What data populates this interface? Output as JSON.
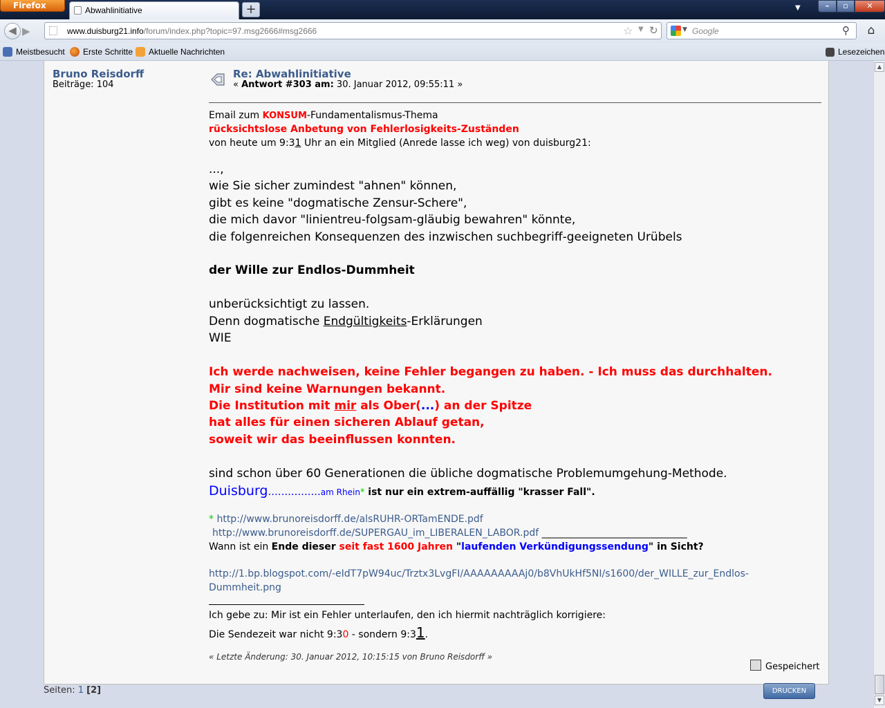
{
  "browser": {
    "menu_button": "Firefox",
    "tab_title": "Abwahlinitiative",
    "new_tab": "+",
    "url_host": "www.duisburg21.info",
    "url_path": "/forum/index.php?topic=97.msg2666#msg2666",
    "search_placeholder": "Google",
    "bookmarks": [
      "Meistbesucht",
      "Erste Schritte",
      "Aktuelle Nachrichten"
    ],
    "bookmarks_menu": "Lesezeichen"
  },
  "post": {
    "author": "Bruno Reisdorff",
    "posts_count": "Beiträge: 104",
    "subject": "Re: Abwahlinitiative",
    "meta_prefix": "« ",
    "meta_reply": "Antwort #303 am:",
    "meta_date": " 30. Januar 2012, 09:55:11 »",
    "l1a": "Email zum ",
    "l1b": "KONSUM",
    "l1c": "-Fundamentalismus-Thema",
    "l2": "rücksichtslose Anbetung von Fehlerlosigkeits-Zuständen",
    "l3a": " von heute um 9:3",
    "l3b": "1",
    "l3c": " Uhr an ein Mitglied (Anrede lasse ich weg) von duisburg21:",
    "l4": "...,",
    "l5": "wie Sie sicher zumindest \"ahnen\" können,",
    "l6": "gibt es keine \"dogmatische Zensur-Schere\",",
    "l7": "die mich davor \"linientreu-folgsam-gläubig bewahren\" könnte,",
    "l8": "die folgenreichen Konsequenzen des inzwischen suchbegriff-geeigneten Urübels",
    "l9": "der Wille zur Endlos-Dummheit",
    "l10": "unberücksichtigt zu lassen.",
    "l11a": "Denn dogmatische ",
    "l11b": "Endgültigkeits",
    "l11c": "-Erklärungen",
    "l12": "WIE",
    "l13": "Ich werde nachweisen, keine Fehler begangen zu haben. - Ich muss das durchhalten.",
    "l14": "Mir sind keine Warnungen bekannt.",
    "l15a": "Die Institution mit ",
    "l15b": "mir",
    "l15c": " als Ober(",
    "l15d": "...",
    "l15e": ") an der Spitze",
    "l16": "hat alles für einen sicheren Ablauf getan,",
    "l17": "soweit wir das beeinflussen konnten.",
    "l18": "sind schon über 60 Generationen die übliche dogmatische Problemumgehung-Methode.",
    "l19a": "Duisburg",
    "l19b": "................",
    "l19c": "am Rhein",
    "l19d": "*",
    "l19e": " ist nur ein extrem-auffällig \"krasser Fall\".",
    "l20a": "* ",
    "l20b": "http://www.brunoreisdorff.de/alsRUHR-ORTamENDE.pdf",
    "l21a": "http://www.brunoreisdorff.de/SUPERGAU_im_LIBERALEN_LABOR.pdf",
    "l21b": " ______________________________",
    "l22a": " Wann ist ein ",
    "l22b": "Ende dieser",
    "l22c": " seit fast 1600 Jahren",
    "l22d": " \"",
    "l22e": "laufenden Verkündigungssendung",
    "l22f": "\" in Sicht?",
    "l23": "http://1.bp.blogspot.com/-eIdT7pW94uc/Trztx3LvgFI/AAAAAAAAAj0/b8VhUkHf5NI/s1600/der_WILLE_zur_Endlos-",
    "l24": "Dummheit.png",
    "l25": "Ich gebe zu: Mir ist ein Fehler unterlaufen, den ich hiermit nachträglich korrigiere:",
    "l26a": "Die Sendezeit war nicht 9:3",
    "l26b": "0",
    "l26c": " - sondern 9:3",
    "l26d": "1",
    "l26e": ".",
    "edited": "« Letzte Änderung: 30. Januar 2012, 10:15:15 von Bruno Reisdorff »",
    "saved": "Gespeichert"
  },
  "footer": {
    "pages_label": "Seiten: ",
    "page1": "1",
    "page2": "[2]",
    "print": "DRUCKEN"
  }
}
